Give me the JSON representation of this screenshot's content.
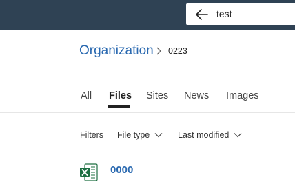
{
  "search": {
    "query": "test"
  },
  "breadcrumb": {
    "root": "Organization",
    "current": "0223"
  },
  "tabs": [
    {
      "label": "All"
    },
    {
      "label": "Files",
      "active": true
    },
    {
      "label": "Sites"
    },
    {
      "label": "News"
    },
    {
      "label": "Images"
    }
  ],
  "filters": {
    "label": "Filters",
    "file_type": "File type",
    "last_modified": "Last modified"
  },
  "results": [
    {
      "title": "0000",
      "icon": "excel-file-icon"
    }
  ],
  "colors": {
    "topbar": "#2f4254",
    "link": "#2a69b0",
    "excel_green": "#1d6f42"
  }
}
